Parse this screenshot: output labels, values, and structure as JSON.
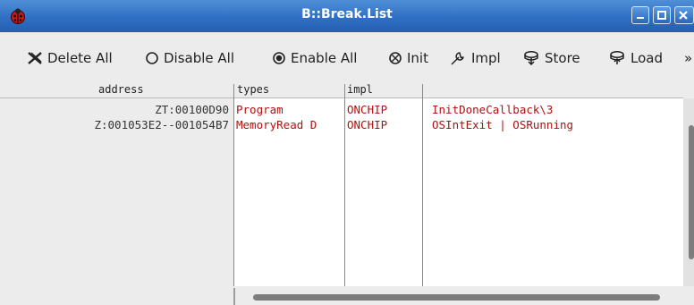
{
  "window": {
    "title": "B::Break.List",
    "app_icon": "ladybug-icon",
    "controls": [
      "minimize-icon",
      "maximize-icon",
      "close-icon"
    ]
  },
  "toolbar": {
    "delete_all": "Delete All",
    "disable_all": "Disable All",
    "enable_all": "Enable All",
    "init": "Init",
    "impl": "Impl",
    "store": "Store",
    "load": "Load",
    "more": "»"
  },
  "table": {
    "columns": {
      "address": "address",
      "types": "types",
      "impl": "impl"
    },
    "rows": [
      {
        "address": "ZT:00100D90",
        "types": "Program",
        "impl": "ONCHIP",
        "action": "InitDoneCallback\\3"
      },
      {
        "address": "Z:001053E2--001054B7",
        "types": "MemoryRead D",
        "impl": "ONCHIP",
        "action": "OSIntExit | OSRunning"
      }
    ]
  },
  "colors": {
    "titlebar": "#2f6fc3",
    "value_text": "#b01010"
  }
}
